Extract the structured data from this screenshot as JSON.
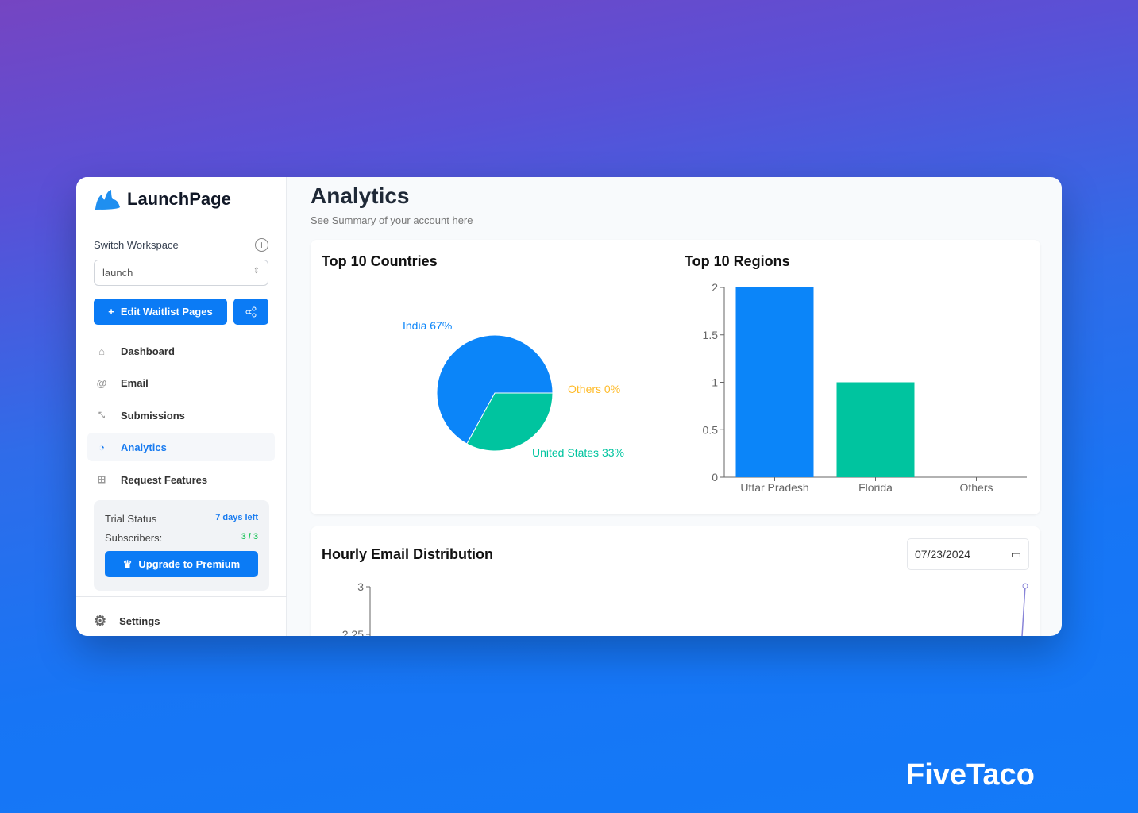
{
  "app": {
    "name": "LaunchPage"
  },
  "sidebar": {
    "switch_workspace": "Switch Workspace",
    "workspace_value": "launch",
    "edit_button": "Edit Waitlist Pages",
    "items": [
      {
        "label": "Dashboard",
        "icon": "home-icon"
      },
      {
        "label": "Email",
        "icon": "at-icon"
      },
      {
        "label": "Submissions",
        "icon": "collapse-icon"
      },
      {
        "label": "Analytics",
        "icon": "pie-chart-icon",
        "active": true
      },
      {
        "label": "Request Features",
        "icon": "feature-board-icon"
      }
    ],
    "trial": {
      "status_label": "Trial Status",
      "status_value": "7 days left",
      "subs_label": "Subscribers:",
      "subs_value": "3 / 3",
      "upgrade": "Upgrade to Premium"
    },
    "settings": "Settings"
  },
  "page": {
    "title": "Analytics",
    "subtitle": "See Summary of your account here"
  },
  "colors": {
    "accent": "#0b7bf5",
    "blue": "#0b85f9",
    "green": "#00c49f",
    "orange": "#ffbb28",
    "line": "#8884d8"
  },
  "chart_data": [
    {
      "type": "pie",
      "title": "Top 10 Countries",
      "slices": [
        {
          "label": "India",
          "value": 67
        },
        {
          "label": "United States",
          "value": 33
        },
        {
          "label": "Others",
          "value": 0
        }
      ],
      "labels": [
        "India 67%",
        "United States 33%",
        "Others 0%"
      ]
    },
    {
      "type": "bar",
      "title": "Top 10 Regions",
      "categories": [
        "Uttar Pradesh",
        "Florida",
        "Others"
      ],
      "values": [
        2,
        1,
        0
      ],
      "ylim": [
        0,
        2
      ],
      "yticks": [
        "0",
        "0.5",
        "1",
        "1.5",
        "2"
      ]
    },
    {
      "type": "line",
      "title": "Hourly Email Distribution",
      "date": "07/23/2024",
      "yticks": [
        "3",
        "2.25"
      ]
    }
  ],
  "footer": {
    "brand": "FiveTaco"
  }
}
